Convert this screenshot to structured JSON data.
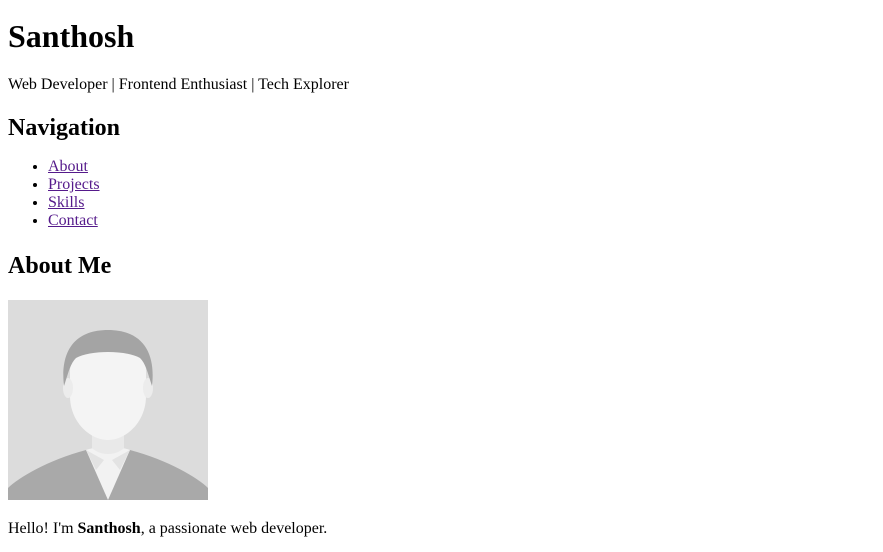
{
  "header": {
    "name": "Santhosh",
    "tagline": "Web Developer | Frontend Enthusiast | Tech Explorer"
  },
  "navigation": {
    "heading": "Navigation",
    "links": [
      {
        "label": "About"
      },
      {
        "label": "Projects"
      },
      {
        "label": "Skills"
      },
      {
        "label": "Contact"
      }
    ],
    "link_color": "#551a8b"
  },
  "about": {
    "heading": "About Me",
    "avatar_icon": "default-avatar-placeholder",
    "intro_prefix": "Hello! I'm ",
    "intro_name": "Santhosh",
    "intro_suffix": ", a passionate web developer."
  }
}
